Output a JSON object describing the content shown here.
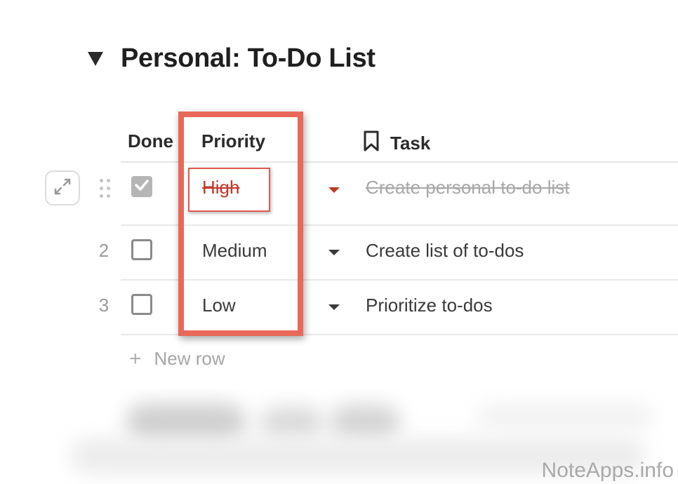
{
  "page": {
    "title": "Personal: To-Do List"
  },
  "table": {
    "columns": {
      "done": "Done",
      "priority": "Priority",
      "task": "Task"
    },
    "rows": [
      {
        "number": "",
        "done": true,
        "priority": "High",
        "task": "Create personal to-do list"
      },
      {
        "number": "2",
        "done": false,
        "priority": "Medium",
        "task": "Create list of to-dos"
      },
      {
        "number": "3",
        "done": false,
        "priority": "Low",
        "task": "Prioritize to-dos"
      }
    ],
    "new_row_label": "New row"
  },
  "icons": {
    "toggle": "triangle-down-icon",
    "task_column": "bookmark-icon",
    "expand": "expand-arrows-icon",
    "drag": "drag-handle-icon",
    "checkbox_checked": "checkmark-icon",
    "dropdown": "caret-down-icon",
    "add": "plus-icon"
  },
  "colors": {
    "highlight": "#e8685a",
    "high_priority": "#c0392b",
    "completed_text": "#a8a8a8"
  },
  "watermark": "NoteApps.info"
}
